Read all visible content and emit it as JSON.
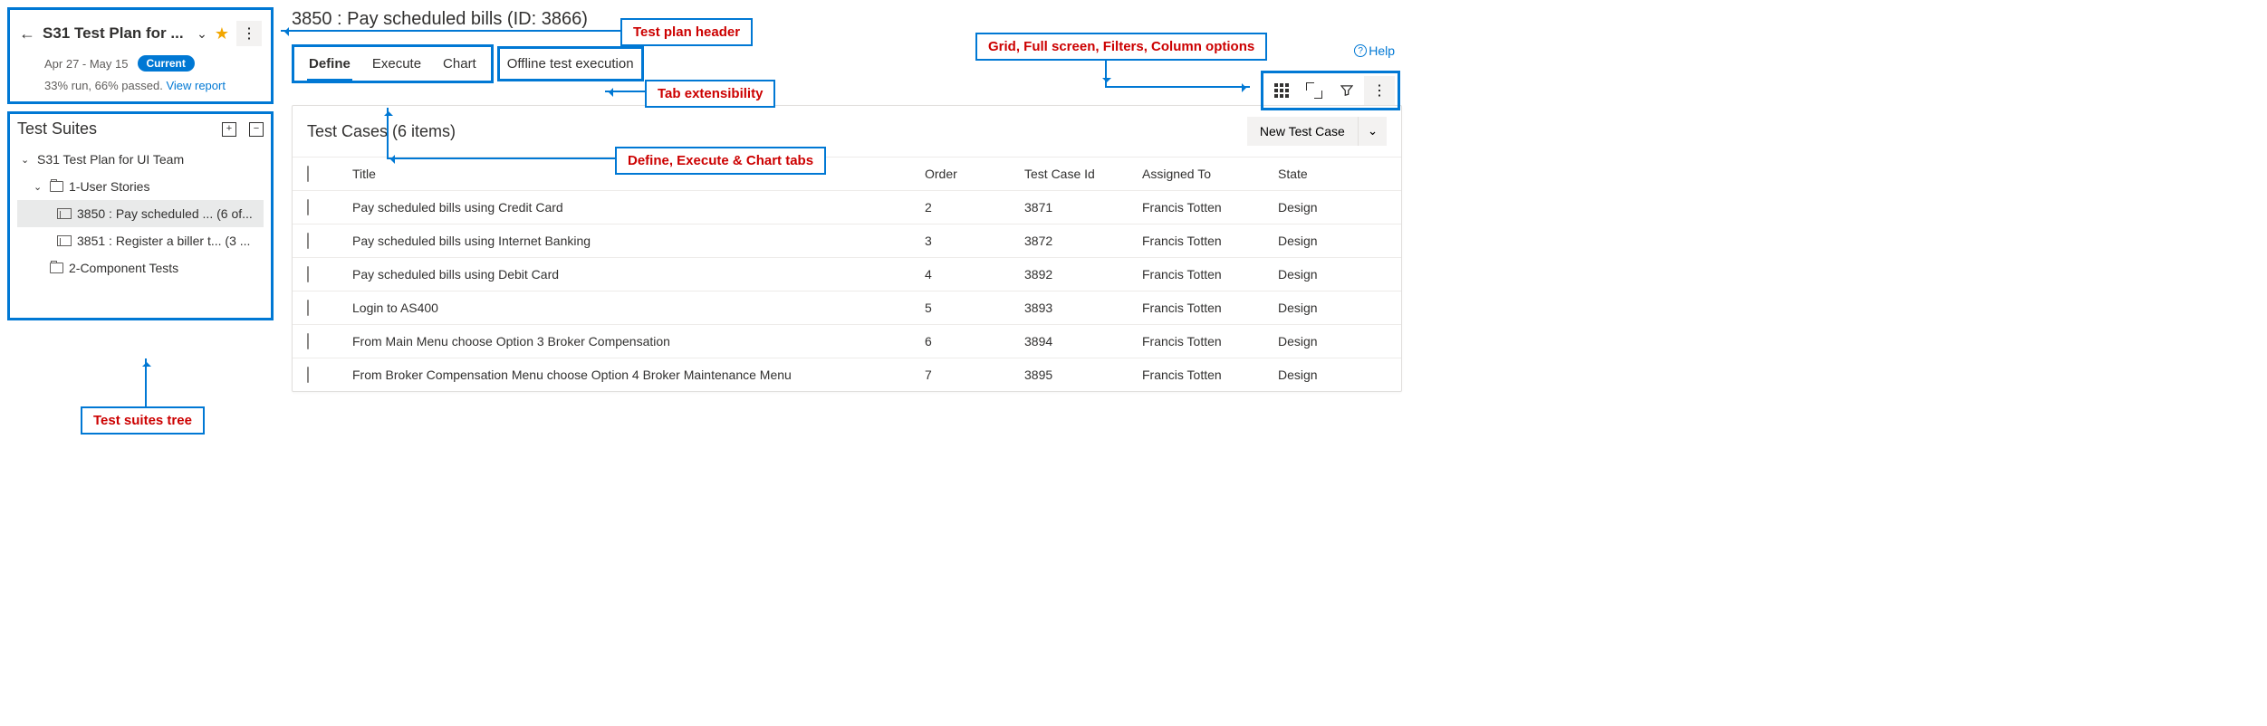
{
  "plan_header": {
    "title": "S31 Test Plan for ...",
    "date_range": "Apr 27 - May 15",
    "badge": "Current",
    "stats": "33% run, 66% passed.",
    "view_report": "View report"
  },
  "suites": {
    "heading": "Test Suites",
    "root": "S31 Test Plan for UI Team",
    "items": [
      {
        "label": "1-User Stories",
        "type": "folder"
      },
      {
        "label": "3850 : Pay scheduled ... (6 of...",
        "type": "req",
        "selected": true
      },
      {
        "label": "3851 : Register a biller t...  (3 ...",
        "type": "req"
      },
      {
        "label": "2-Component Tests",
        "type": "folder"
      }
    ]
  },
  "suite_title": "3850 : Pay scheduled bills (ID: 3866)",
  "tabs": {
    "define": "Define",
    "execute": "Execute",
    "chart": "Chart",
    "offline": "Offline test execution"
  },
  "help": "Help",
  "card": {
    "title": "Test Cases (6 items)",
    "new_button": "New Test Case"
  },
  "columns": {
    "title": "Title",
    "order": "Order",
    "tcid": "Test Case Id",
    "assigned": "Assigned To",
    "state": "State"
  },
  "rows": [
    {
      "title": "Pay scheduled bills using Credit Card",
      "order": "2",
      "tcid": "3871",
      "assigned": "Francis Totten",
      "state": "Design"
    },
    {
      "title": "Pay scheduled bills using Internet Banking",
      "order": "3",
      "tcid": "3872",
      "assigned": "Francis Totten",
      "state": "Design"
    },
    {
      "title": "Pay scheduled bills using Debit Card",
      "order": "4",
      "tcid": "3892",
      "assigned": "Francis Totten",
      "state": "Design"
    },
    {
      "title": "Login to AS400",
      "order": "5",
      "tcid": "3893",
      "assigned": "Francis Totten",
      "state": "Design"
    },
    {
      "title": "From Main Menu choose Option 3 Broker Compensation",
      "order": "6",
      "tcid": "3894",
      "assigned": "Francis Totten",
      "state": "Design"
    },
    {
      "title": "From Broker Compensation Menu choose Option 4 Broker Maintenance Menu",
      "order": "7",
      "tcid": "3895",
      "assigned": "Francis Totten",
      "state": "Design"
    }
  ],
  "annotations": {
    "plan_header": "Test plan header",
    "tab_ext": "Tab extensibility",
    "tabs": "Define, Execute & Chart tabs",
    "toolbar": "Grid, Full screen, Filters, Column options",
    "tree": "Test suites tree"
  }
}
